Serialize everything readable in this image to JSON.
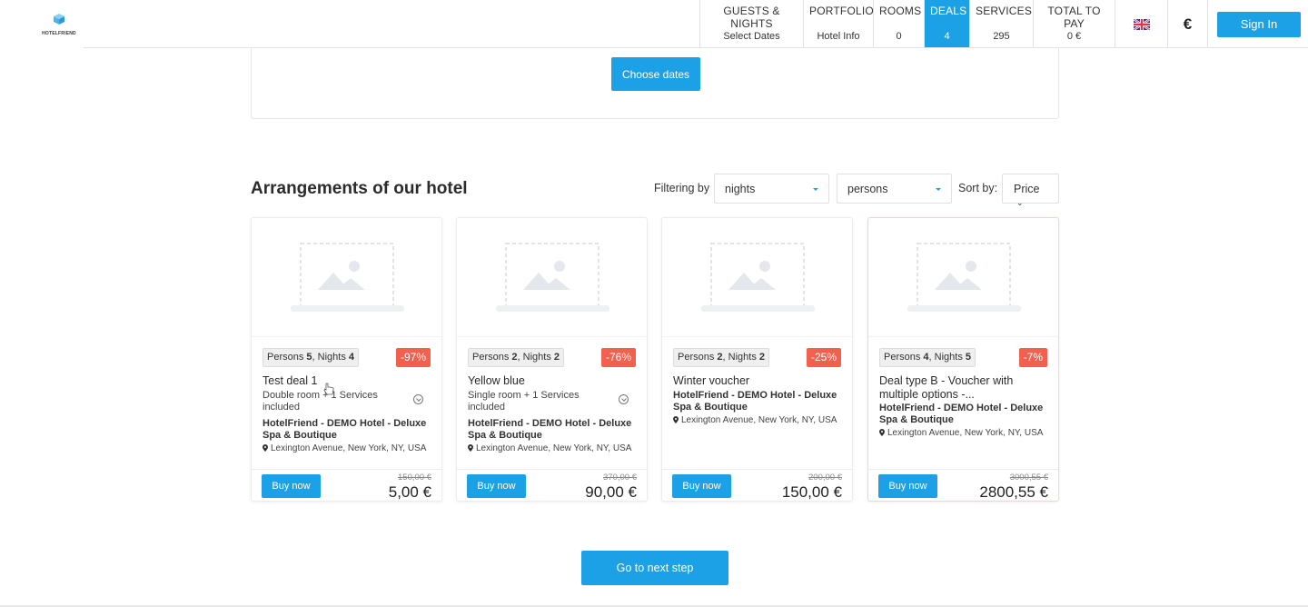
{
  "brand": {
    "name": "HOTELFRIEND"
  },
  "nav": [
    {
      "label": "GUESTS & NIGHTS",
      "value": "Select Dates",
      "active": false
    },
    {
      "label": "PORTFOLIO",
      "value": "Hotel Info",
      "active": false
    },
    {
      "label": "ROOMS",
      "value": "0",
      "active": false
    },
    {
      "label": "DEALS",
      "value": "4",
      "active": true
    },
    {
      "label": "SERVICES",
      "value": "295",
      "active": false
    },
    {
      "label": "TOTAL TO PAY",
      "value": "0 €",
      "active": false
    }
  ],
  "language": {
    "icon": "uk-flag-icon"
  },
  "currency": {
    "symbol": "€"
  },
  "signin_label": "Sign In",
  "dates": {
    "button_label": "Choose dates"
  },
  "section": {
    "title": "Arrangements of our hotel",
    "filter_label": "Filtering by",
    "nights_select": "nights",
    "persons_select": "persons",
    "sort_label": "Sort by:",
    "sort_select": "Price"
  },
  "deals": [
    {
      "persons_label": "Persons",
      "persons": "5",
      "nights_label": "Nights",
      "nights": "4",
      "discount": "-97%",
      "title": "Test deal 1",
      "description": "Double room + 1 Services included",
      "hotel": "HotelFriend - DEMO Hotel - Deluxe Spa & Boutique",
      "address": "Lexington Avenue, New York, NY, USA",
      "old_price": "150,00 €",
      "price": "5,00 €",
      "buy_label": "Buy now"
    },
    {
      "persons_label": "Persons",
      "persons": "2",
      "nights_label": "Nights",
      "nights": "2",
      "discount": "-76%",
      "title": "Yellow blue",
      "description": "Single room + 1 Services included",
      "hotel": "HotelFriend - DEMO Hotel - Deluxe Spa & Boutique",
      "address": "Lexington Avenue, New York, NY, USA",
      "old_price": "370,00 €",
      "price": "90,00 €",
      "buy_label": "Buy now"
    },
    {
      "persons_label": "Persons",
      "persons": "2",
      "nights_label": "Nights",
      "nights": "2",
      "discount": "-25%",
      "title": "Winter voucher",
      "hotel": "HotelFriend - DEMO Hotel - Deluxe Spa & Boutique",
      "address": "Lexington Avenue, New York, NY, USA",
      "old_price": "200,00 €",
      "price": "150,00 €",
      "buy_label": "Buy now"
    },
    {
      "persons_label": "Persons",
      "persons": "4",
      "nights_label": "Nights",
      "nights": "5",
      "discount": "-7%",
      "title": "Deal type B - Voucher with multiple options -...",
      "hotel": "HotelFriend - DEMO Hotel - Deluxe Spa & Boutique",
      "address": "Lexington Avenue, New York, NY, USA",
      "old_price": "3000,55 €",
      "price": "2800,55 €",
      "buy_label": "Buy now"
    }
  ],
  "next_step_label": "Go to next step"
}
